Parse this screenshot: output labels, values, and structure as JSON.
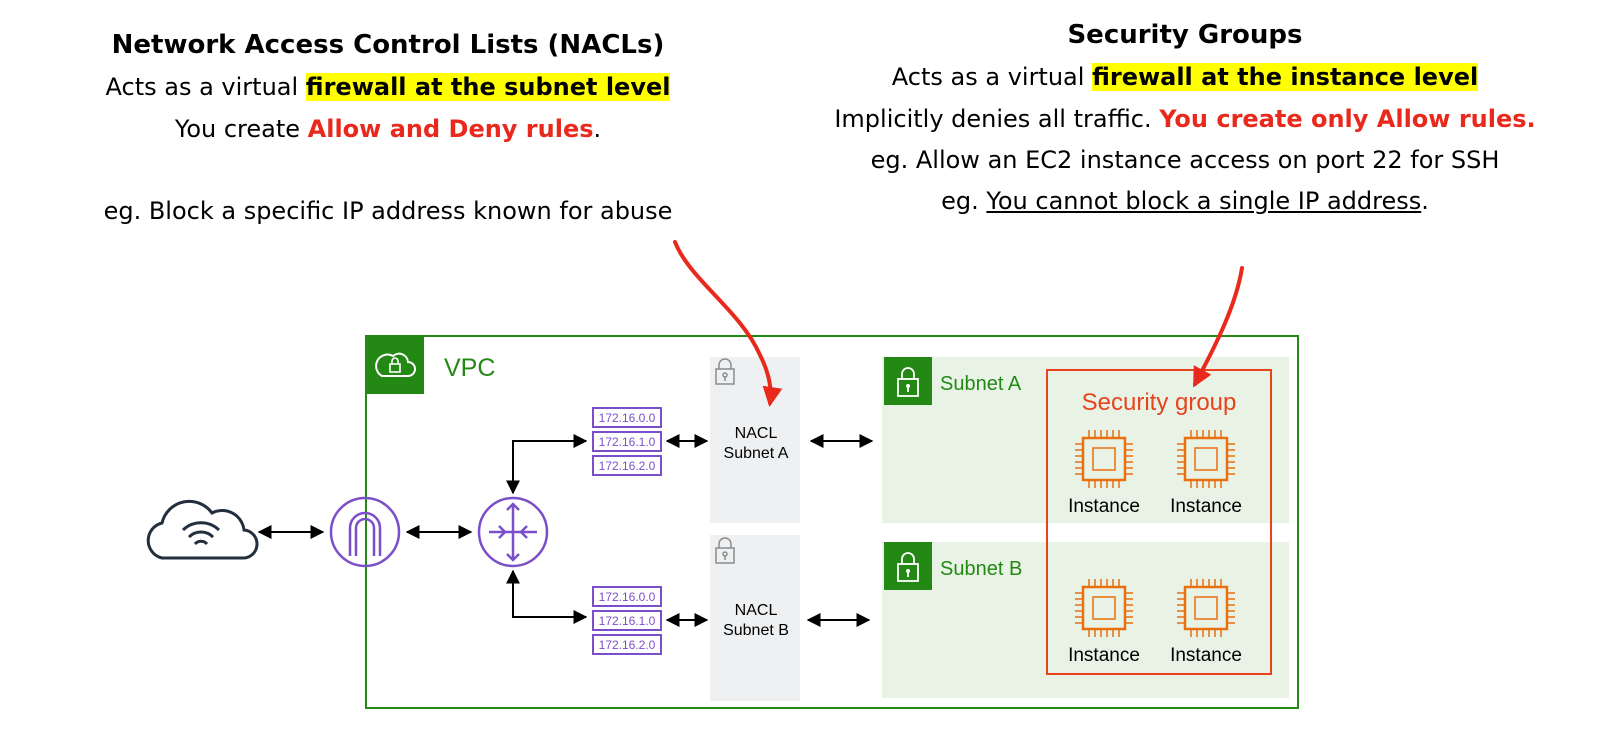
{
  "nacl": {
    "title": "Network Access Control Lists (NACLs)",
    "line1_prefix": "Acts as a virtual ",
    "line1_highlight": "firewall at the subnet level",
    "line2_prefix": "You create ",
    "line2_red": "Allow and Deny rules",
    "line2_suffix": ".",
    "example": "eg. Block a specific IP address known for abuse"
  },
  "sg": {
    "title": "Security Groups",
    "line1_prefix": "Acts as a virtual ",
    "line1_highlight": "firewall at the instance level",
    "line2_prefix": "Implicitly denies all traffic. ",
    "line2_red": "You create only Allow rules.",
    "example1": "eg. Allow an EC2 instance access on port 22 for SSH",
    "example2_prefix": "eg. ",
    "example2_underline": "You cannot block a single IP address",
    "example2_suffix": "."
  },
  "diagram": {
    "vpc_label": "VPC",
    "route_tables": [
      "172.16.0.0",
      "172.16.1.0",
      "172.16.2.0"
    ],
    "nacl_a_line1": "NACL",
    "nacl_a_line2": "Subnet A",
    "nacl_b_line1": "NACL",
    "nacl_b_line2": "Subnet B",
    "subnet_a_label": "Subnet A",
    "subnet_b_label": "Subnet B",
    "security_group_label": "Security group",
    "instance_label": "Instance"
  },
  "colors": {
    "vpc_green": "#248814",
    "subnet_bg": "#e8f3e6",
    "nacl_bg": "#eef0f2",
    "purple": "#7b4fc9",
    "orange": "#e9700f",
    "sg_red": "#e8431c",
    "annotation_red": "#e8291c",
    "highlight": "#ffff00"
  }
}
